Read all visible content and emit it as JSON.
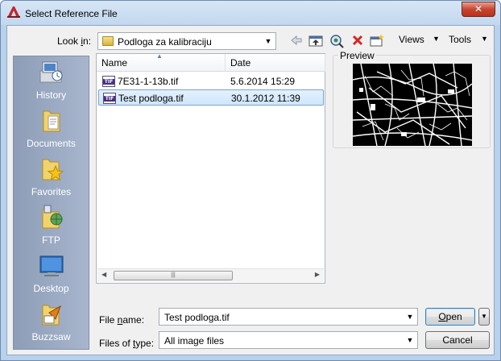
{
  "window": {
    "title": "Select Reference File",
    "close_glyph": "✕"
  },
  "toolbar": {
    "look_in_label_prefix": "Look ",
    "look_in_label_mnemonic": "i",
    "look_in_label_suffix": "n:",
    "look_in_value": "Podloga za kalibraciju",
    "views_label": "Views",
    "tools_label": "Tools",
    "icons": [
      "back-icon",
      "up-folder-icon",
      "search-web-icon",
      "delete-icon",
      "new-folder-icon"
    ]
  },
  "places": [
    {
      "label": "History",
      "icon": "history-icon"
    },
    {
      "label": "Documents",
      "icon": "documents-icon"
    },
    {
      "label": "Favorites",
      "icon": "favorites-icon"
    },
    {
      "label": "FTP",
      "icon": "ftp-icon"
    },
    {
      "label": "Desktop",
      "icon": "desktop-icon"
    },
    {
      "label": "Buzzsaw",
      "icon": "buzzsaw-icon"
    }
  ],
  "filelist": {
    "columns": [
      "Name",
      "Date"
    ],
    "rows": [
      {
        "name": "7E31-1-13b.tif",
        "date": "5.6.2014 15:29",
        "icon_text": "TIF",
        "selected": false
      },
      {
        "name": "Test podloga.tif",
        "date": "30.1.2012 11:39",
        "icon_text": "TIF",
        "selected": true
      }
    ]
  },
  "preview": {
    "label": "Preview"
  },
  "bottom": {
    "file_name_label_prefix": "File ",
    "file_name_label_mnemonic": "n",
    "file_name_label_suffix": "ame:",
    "file_name_value": "Test podloga.tif",
    "files_of_type_label_prefix": "Files of ",
    "files_of_type_label_mnemonic": "t",
    "files_of_type_label_suffix": "ype:",
    "files_of_type_value": "All image files",
    "open_label_mnemonic": "O",
    "open_label_suffix": "pen",
    "cancel_label": "Cancel"
  },
  "colors": {
    "frame": "#b9d1ea",
    "places_bar": "#97a7c0",
    "selection": "#cde6fc",
    "close_button": "#c7452f"
  }
}
